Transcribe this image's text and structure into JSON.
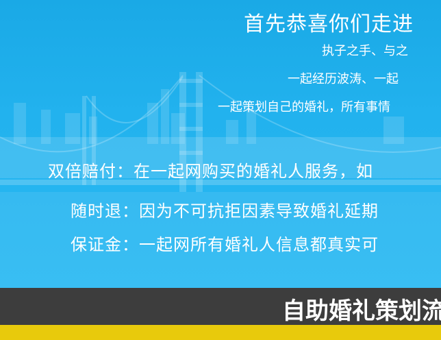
{
  "hero": {
    "headline": "首先恭喜你们走进",
    "line2": "执子之手、与之",
    "line3": "一起经历波涛、一起",
    "line4": "一起策划自己的婚礼，所有事情",
    "guarantees": [
      "双倍赔付：在一起网购买的婚礼人服务，如",
      "随时退：因为不可抗拒因素导致婚礼延期",
      "保证金：一起网所有婚礼人信息都真实可"
    ]
  },
  "band": {
    "title": "自助婚礼策划流"
  },
  "colors": {
    "sky": "#22b2ee",
    "band": "#3d3d3d",
    "stripe": "#e8ca0c"
  }
}
